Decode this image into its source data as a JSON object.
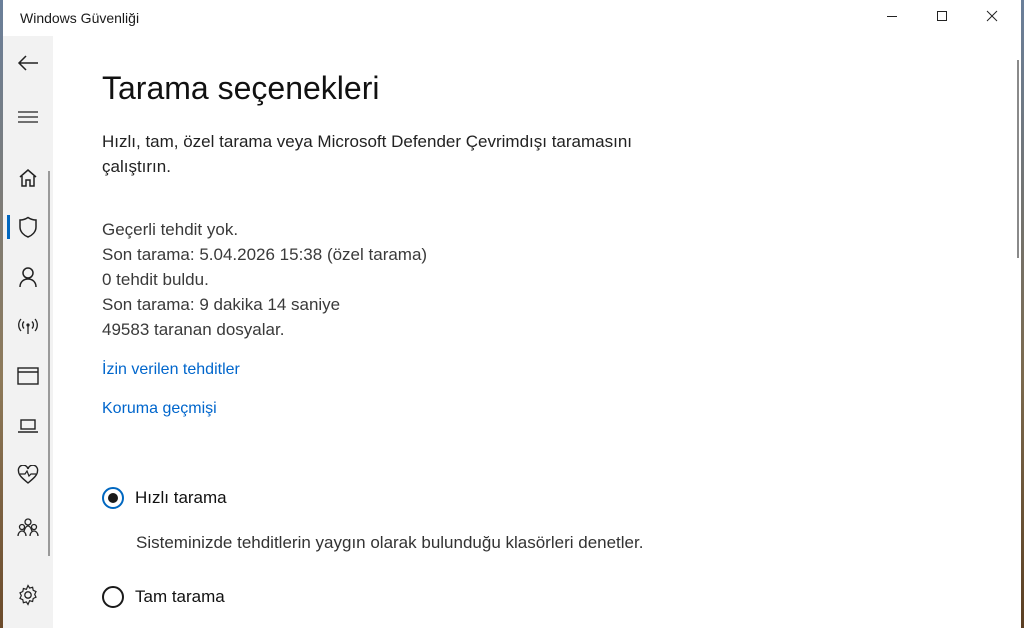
{
  "window": {
    "title": "Windows Güvenliği"
  },
  "nav": {
    "items": [
      {
        "icon": "back-arrow-icon"
      },
      {
        "icon": "hamburger-menu-icon"
      },
      {
        "icon": "home-icon"
      },
      {
        "icon": "shield-icon",
        "active": true
      },
      {
        "icon": "person-icon"
      },
      {
        "icon": "wireless-icon"
      },
      {
        "icon": "app-browser-icon"
      },
      {
        "icon": "laptop-icon"
      },
      {
        "icon": "heart-pulse-icon"
      },
      {
        "icon": "family-icon"
      },
      {
        "icon": "gear-icon"
      }
    ]
  },
  "main": {
    "title": "Tarama seçenekleri",
    "description": "Hızlı, tam, özel tarama veya Microsoft Defender Çevrimdışı taramasını çalıştırın.",
    "status": {
      "threats": "Geçerli tehdit yok.",
      "last_scan": "Son tarama: 5.04.2026 15:38 (özel tarama)",
      "found": "0 tehdit buldu.",
      "duration": "Son tarama: 9 dakika 14 saniye",
      "files": "49583 taranan dosyalar."
    },
    "links": {
      "allowed_threats": "İzin verilen tehditler",
      "protection_history": "Koruma geçmişi"
    },
    "scan_options": [
      {
        "label": "Hızlı tarama",
        "description": "Sisteminizde tehditlerin yaygın olarak bulunduğu klasörleri denetler.",
        "selected": true
      },
      {
        "label": "Tam tarama",
        "selected": false
      }
    ]
  },
  "colors": {
    "accent": "#0067c0",
    "link": "#0066cc",
    "nav_bg": "#f2f2f2"
  }
}
